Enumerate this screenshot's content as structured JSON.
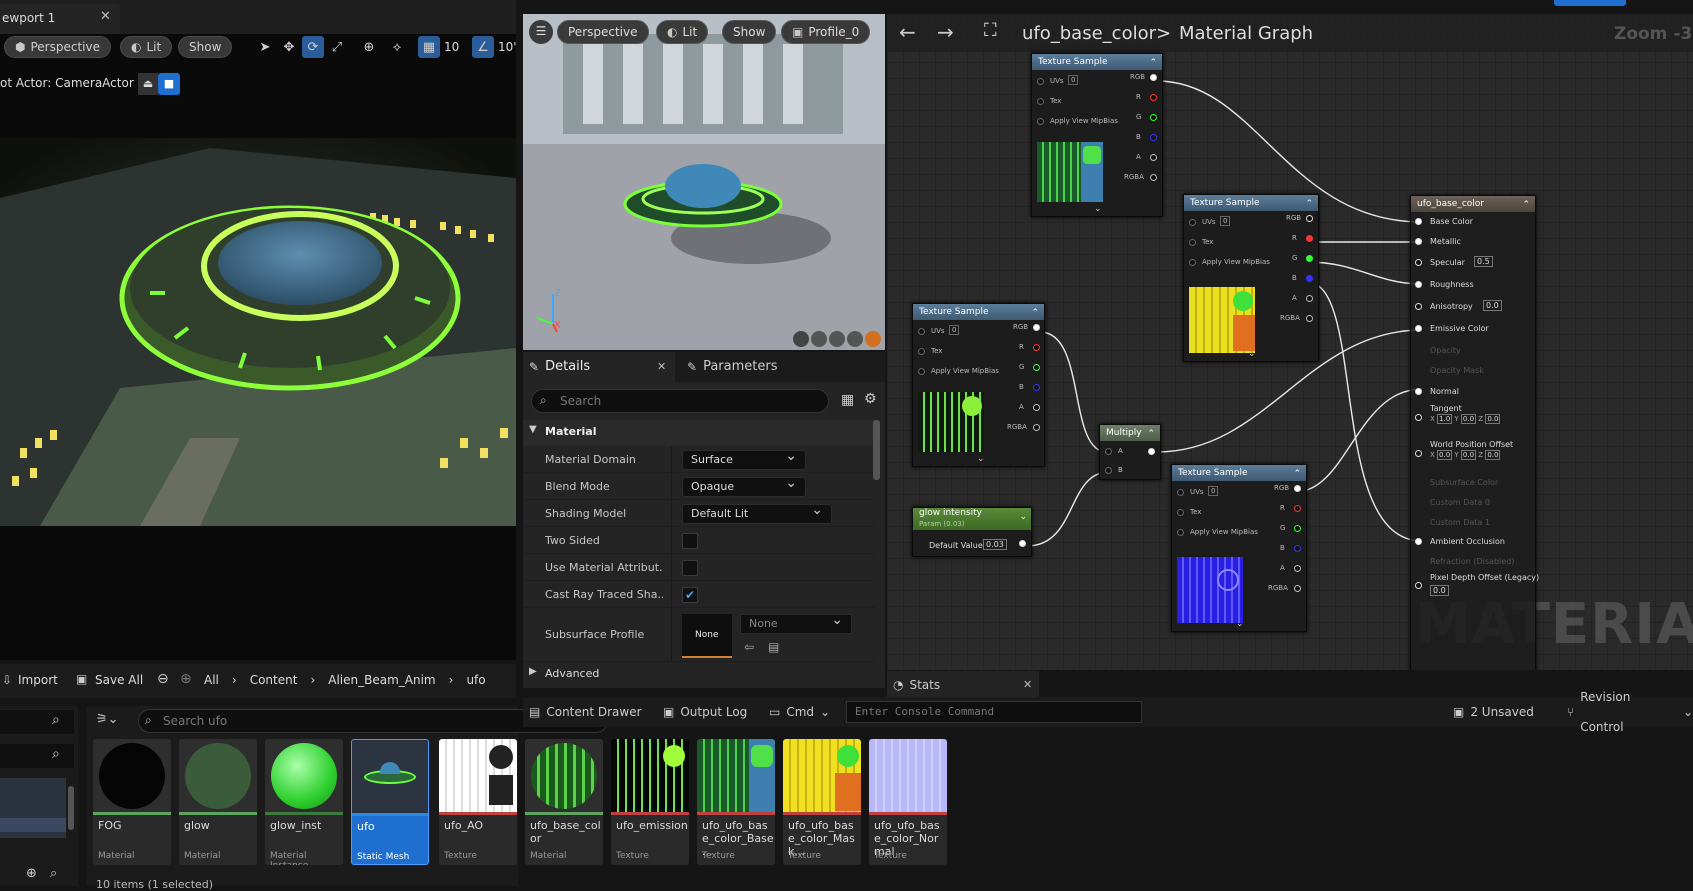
{
  "left_viewport": {
    "tab_title": "ewport 1",
    "perspective": "Perspective",
    "lit": "Lit",
    "show": "Show",
    "grid_size": "10",
    "angle_size": "10'",
    "pilot_label": "ot Actor: CameraActor"
  },
  "preview": {
    "perspective": "Perspective",
    "lit": "Lit",
    "show": "Show",
    "profile": "Profile_0",
    "axis_z": "Z",
    "axis_x": "X"
  },
  "details": {
    "tab_label": "Details",
    "params_label": "Parameters",
    "search_placeholder": "Search",
    "section": "Material",
    "advanced": "Advanced",
    "rows": [
      {
        "label": "Material Domain",
        "value": "Surface"
      },
      {
        "label": "Blend Mode",
        "value": "Opaque"
      },
      {
        "label": "Shading Model",
        "value": "Default Lit"
      },
      {
        "label": "Two Sided",
        "checked": false
      },
      {
        "label": "Use Material Attribut...",
        "checked": false
      },
      {
        "label": "Cast Ray Traced Sha...",
        "checked": true
      },
      {
        "label": "Subsurface Profile",
        "thumb": "None",
        "value": "None"
      }
    ]
  },
  "graph": {
    "breadcrumb_asset": "ufo_base_color",
    "breadcrumb_sep": ">",
    "breadcrumb_page": "Material Graph",
    "zoom": "Zoom -3",
    "watermark": "MATERIAL",
    "texture_title": "Texture Sample",
    "uvs": "UVs",
    "uv_val": "0",
    "tex": "Tex",
    "mip": "Apply View MipBias",
    "out_pins": [
      "RGB",
      "R",
      "G",
      "B",
      "A",
      "RGBA"
    ],
    "multiply_title": "Multiply",
    "mult_a": "A",
    "mult_b": "B",
    "param_title": "glow intensity",
    "param_sub": "Param (0.03)",
    "param_default_label": "Default Value",
    "param_default": "0.03",
    "result_title": "ufo_base_color",
    "result_pins": [
      {
        "label": "Base Color",
        "active": true
      },
      {
        "label": "Metallic",
        "active": true
      },
      {
        "label": "Specular",
        "active": true,
        "val": "0.5"
      },
      {
        "label": "Roughness",
        "active": true
      },
      {
        "label": "Anisotropy",
        "active": true,
        "val": "0.0"
      },
      {
        "label": "Emissive Color",
        "active": true
      },
      {
        "label": "Opacity",
        "active": false
      },
      {
        "label": "Opacity Mask",
        "active": false
      },
      {
        "label": "Normal",
        "active": true
      },
      {
        "label": "Tangent",
        "active": true
      },
      {
        "label": "World Position Offset",
        "active": true
      },
      {
        "label": "Subsurface Color",
        "active": false
      },
      {
        "label": "Custom Data 0",
        "active": false
      },
      {
        "label": "Custom Data 1",
        "active": false
      },
      {
        "label": "Ambient Occlusion",
        "active": true
      },
      {
        "label": "Refraction (Disabled)",
        "active": false
      },
      {
        "label": "Pixel Depth Offset (Legacy)",
        "active": true,
        "val": "0.0"
      }
    ],
    "vec_x": "X",
    "vec_y": "Y",
    "vec_z": "Z",
    "tangent_x": "1.0",
    "tangent_y": "0.0",
    "tangent_z": "0.0",
    "wpo_x": "0.0",
    "wpo_y": "0.0",
    "wpo_z": "0.0"
  },
  "stats_tab": "Stats",
  "content_browser": {
    "import": "Import",
    "save_all": "Save All",
    "path": [
      "All",
      "Content",
      "Alien_Beam_Anim",
      "ufo"
    ],
    "search_placeholder": "Search ufo",
    "footer": "10 items (1 selected)",
    "assets": [
      {
        "name": "FOG",
        "type": "Material",
        "bar": "#5da55d"
      },
      {
        "name": "glow",
        "type": "Material",
        "bar": "#5da55d"
      },
      {
        "name": "glow_inst",
        "type": "Material Instance",
        "bar": "#3d7a3d"
      },
      {
        "name": "ufo",
        "type": "Static Mesh",
        "bar": "#2a8ae0"
      },
      {
        "name": "ufo_AO",
        "type": "Texture",
        "bar": "#c04040"
      },
      {
        "name": "ufo_base_color",
        "type": "Material",
        "bar": "#5da55d"
      },
      {
        "name": "ufo_emission",
        "type": "Texture",
        "bar": "#c04040"
      },
      {
        "name": "ufo_ufo_base_color_Base...",
        "type": "Texture",
        "bar": "#c04040"
      },
      {
        "name": "ufo_ufo_base_color_Mask...",
        "type": "Texture",
        "bar": "#c04040"
      },
      {
        "name": "ufo_ufo_base_color_Normal",
        "type": "Texture",
        "bar": "#c04040"
      }
    ]
  },
  "bottom_bar": {
    "content_drawer": "Content Drawer",
    "output_log": "Output Log",
    "cmd": "Cmd",
    "console_placeholder": "Enter Console Command",
    "unsaved": "2 Unsaved",
    "revision": "Revision Control"
  }
}
